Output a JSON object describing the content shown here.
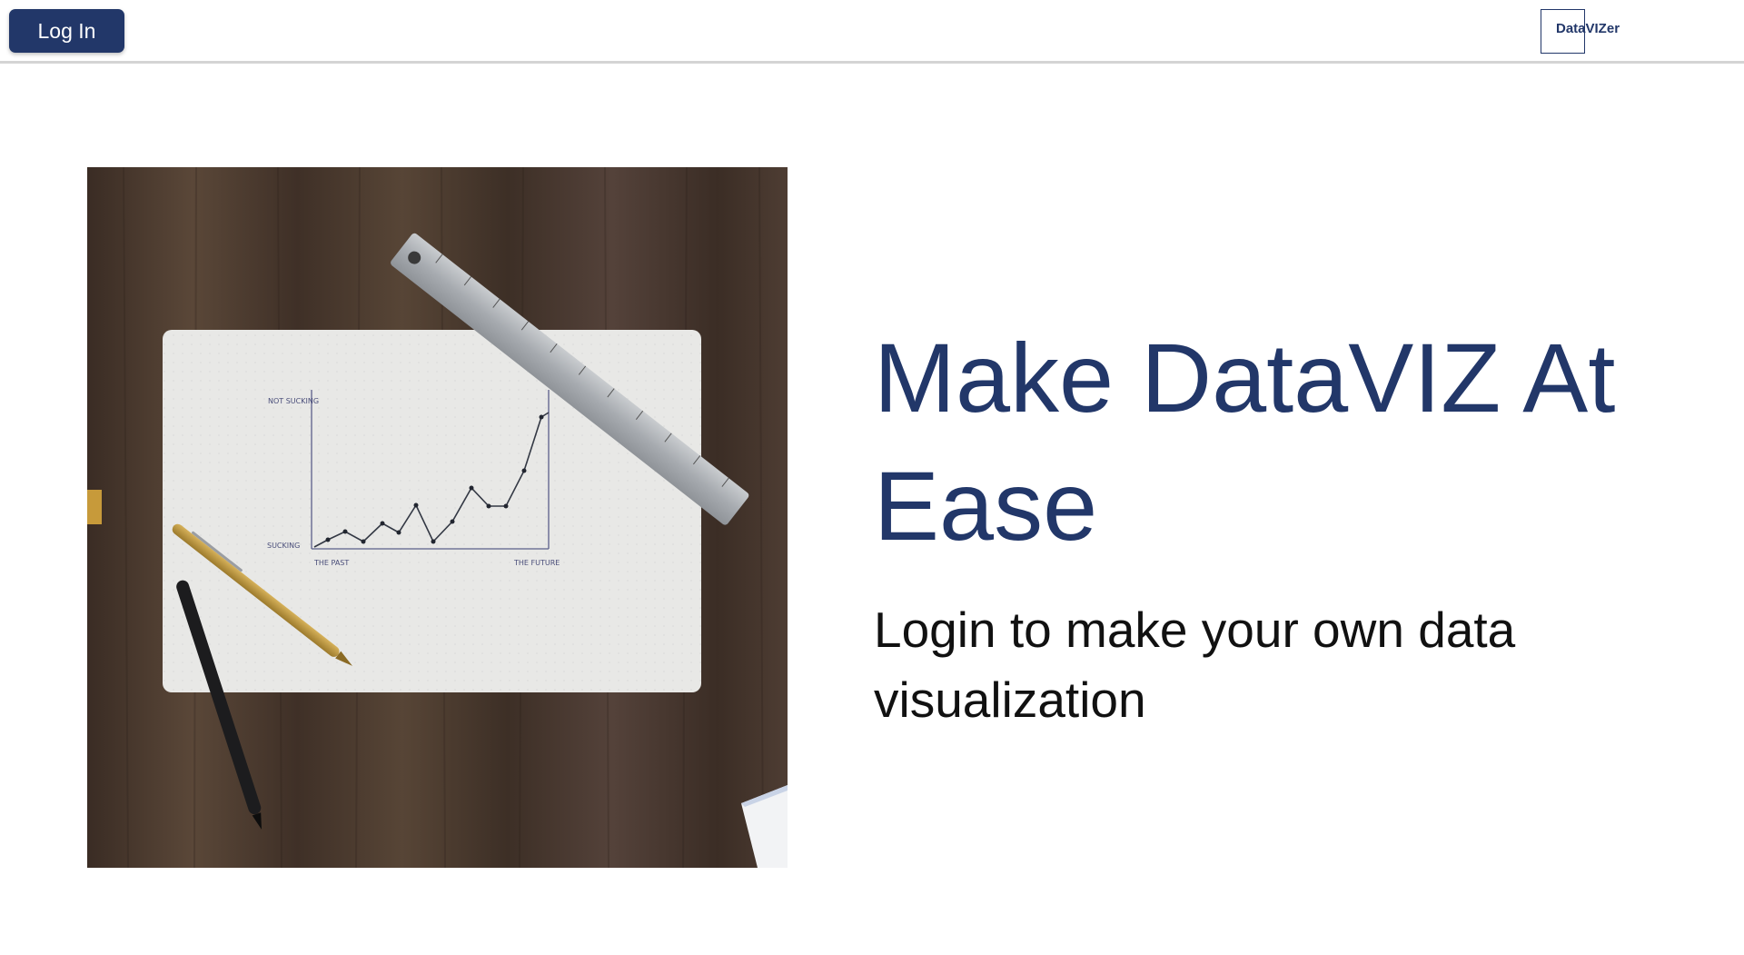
{
  "header": {
    "login_label": "Log In",
    "brand_name": "DataVIZer"
  },
  "hero": {
    "image_icon": "desk-chart-photo",
    "headline": "Make DataVIZ At Ease",
    "subtitle": "Login to make your own data visualization",
    "photo_sketch": {
      "y_top_label": "NOT SUCKING",
      "y_bottom_label": "SUCKING",
      "x_left_label": "THE PAST",
      "x_right_label": "THE FUTURE"
    }
  },
  "colors": {
    "brand": "#223769",
    "header_border": "#d4d4d4",
    "text_dark": "#111111",
    "wood": "#4a3a30"
  }
}
